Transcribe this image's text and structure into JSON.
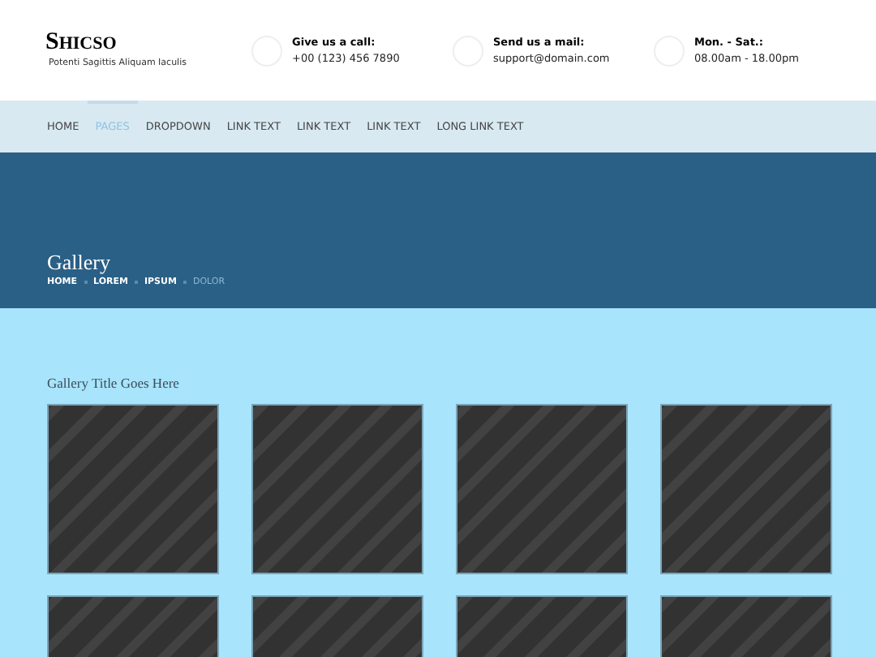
{
  "logo": {
    "name": "SHICSO",
    "tagline": "Potenti Sagittis Aliquam Iaculis"
  },
  "contacts": [
    {
      "label": "Give us a call:",
      "value": "+00 (123) 456 7890"
    },
    {
      "label": "Send us a mail:",
      "value": "support@domain.com"
    },
    {
      "label": "Mon. - Sat.:",
      "value": "08.00am - 18.00pm"
    }
  ],
  "nav": [
    {
      "label": "HOME",
      "selected": false
    },
    {
      "label": "PAGES",
      "selected": true
    },
    {
      "label": "DROPDOWN",
      "selected": false
    },
    {
      "label": "LINK TEXT",
      "selected": false
    },
    {
      "label": "LINK TEXT",
      "selected": false
    },
    {
      "label": "LINK TEXT",
      "selected": false
    },
    {
      "label": "LONG LINK TEXT",
      "selected": false
    }
  ],
  "page_title": "Gallery",
  "breadcrumb": [
    {
      "label": "HOME",
      "selected": false
    },
    {
      "label": "LOREM",
      "selected": false
    },
    {
      "label": "IPSUM",
      "selected": false
    },
    {
      "label": "DOLOR",
      "selected": true
    }
  ],
  "gallery": {
    "title": "Gallery Title Goes Here"
  }
}
